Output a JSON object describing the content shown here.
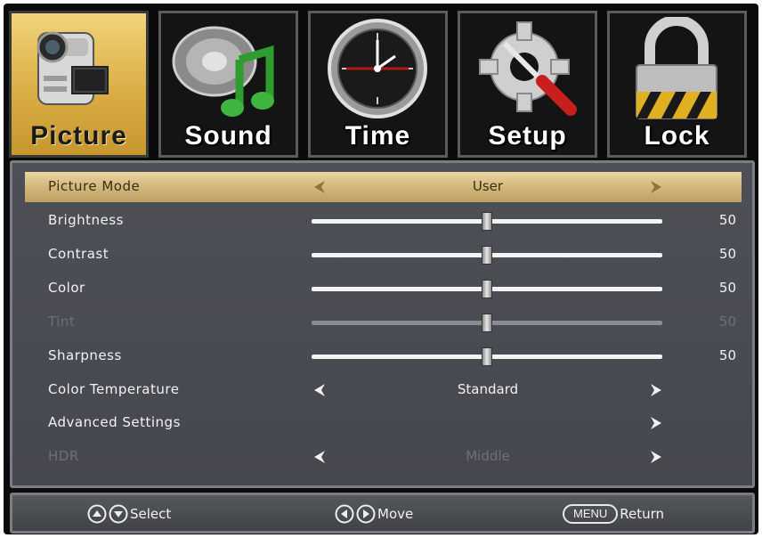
{
  "tabs": [
    {
      "label": "Picture",
      "icon": "camcorder-icon",
      "active": true
    },
    {
      "label": "Sound",
      "icon": "speaker-music-icon",
      "active": false
    },
    {
      "label": "Time",
      "icon": "clock-icon",
      "active": false
    },
    {
      "label": "Setup",
      "icon": "gear-screwdriver-icon",
      "active": false
    },
    {
      "label": "Lock",
      "icon": "padlock-icon",
      "active": false
    }
  ],
  "menu": {
    "picture_mode": {
      "label": "Picture Mode",
      "value": "User"
    },
    "brightness": {
      "label": "Brightness",
      "value": 50,
      "display": "50"
    },
    "contrast": {
      "label": "Contrast",
      "value": 50,
      "display": "50"
    },
    "color": {
      "label": "Color",
      "value": 50,
      "display": "50"
    },
    "tint": {
      "label": "Tint",
      "value": 50,
      "display": "50"
    },
    "sharpness": {
      "label": "Sharpness",
      "value": 50,
      "display": "50"
    },
    "color_temperature": {
      "label": "Color Temperature",
      "value": "Standard"
    },
    "advanced_settings": {
      "label": "Advanced Settings"
    },
    "hdr": {
      "label": "HDR",
      "value": "Middle"
    }
  },
  "footer": {
    "select_label": "Select",
    "move_label": "Move",
    "menu_key": "MENU",
    "return_label": "Return"
  },
  "colors": {
    "active_tab": "#d9ae45",
    "panel_bg": "#4a4d53",
    "selected_row": "#d2b77b",
    "disabled_text": "#6d7076"
  }
}
